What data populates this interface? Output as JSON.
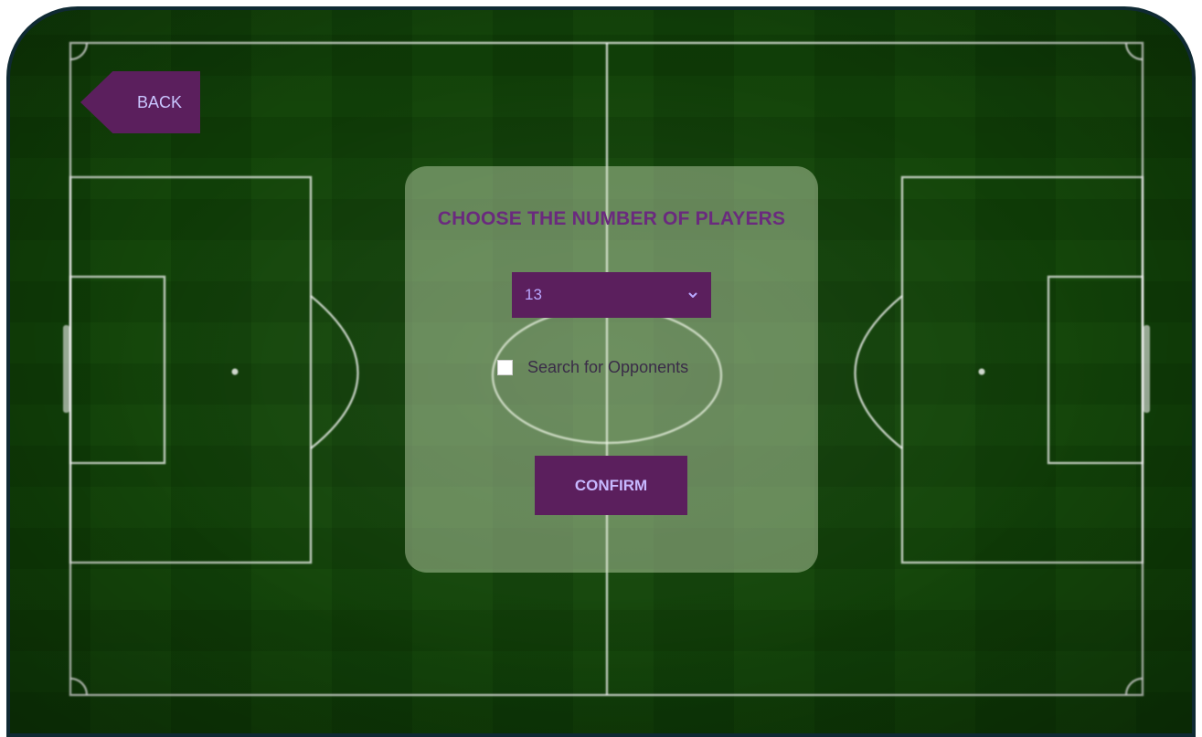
{
  "nav": {
    "back_label": "BACK"
  },
  "panel": {
    "title": "CHOOSE THE NUMBER OF PLAYERS",
    "player_count": {
      "selected": "13"
    },
    "opponents": {
      "label": "Search for Opponents",
      "checked": false
    },
    "confirm_label": "CONFIRM"
  },
  "colors": {
    "accent": "#5b1f5d",
    "title": "#6a2a7e",
    "button_text": "#c7b8ff",
    "frame_border": "#0f2a33",
    "pitch_green": "#3e7d2a"
  },
  "icons": {
    "dropdown": "chevron-down-icon"
  }
}
